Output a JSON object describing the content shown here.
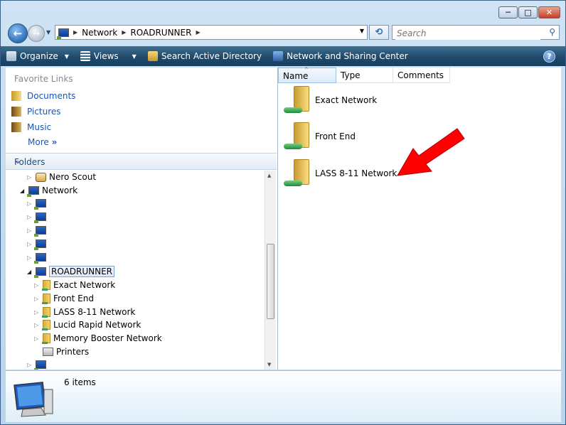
{
  "window": {
    "caption": {
      "minimize": "─",
      "maximize": "□",
      "close": "✕"
    }
  },
  "nav": {
    "back_icon": "back-arrow-icon",
    "forward_icon": "forward-arrow-icon",
    "breadcrumb": [
      "Network",
      "ROADRUNNER"
    ],
    "search_placeholder": "Search"
  },
  "toolbar": {
    "organize": "Organize",
    "views": "Views",
    "search_ad": "Search Active Directory",
    "network_center": "Network and Sharing Center",
    "help": "?"
  },
  "favorites": {
    "title": "Favorite Links",
    "items": [
      "Documents",
      "Pictures",
      "Music"
    ],
    "more": "More"
  },
  "folders": {
    "title": "Folders",
    "tree": {
      "nero_scout": "Nero Scout",
      "network": "Network",
      "roadrunner": "ROADRUNNER",
      "shares": [
        "Exact Network",
        "Front End",
        "LASS 8-11 Network",
        "Lucid Rapid Network",
        "Memory Booster Network"
      ],
      "printers": "Printers"
    }
  },
  "columns": [
    "Name",
    "Type",
    "Comments"
  ],
  "files": [
    "Exact Network",
    "Front End",
    "LASS 8-11 Network"
  ],
  "details": {
    "count": "6 items"
  },
  "colors": {
    "toolbar": "#1f4a6b",
    "link": "#1a55b4",
    "arrow": "#ff0000"
  }
}
